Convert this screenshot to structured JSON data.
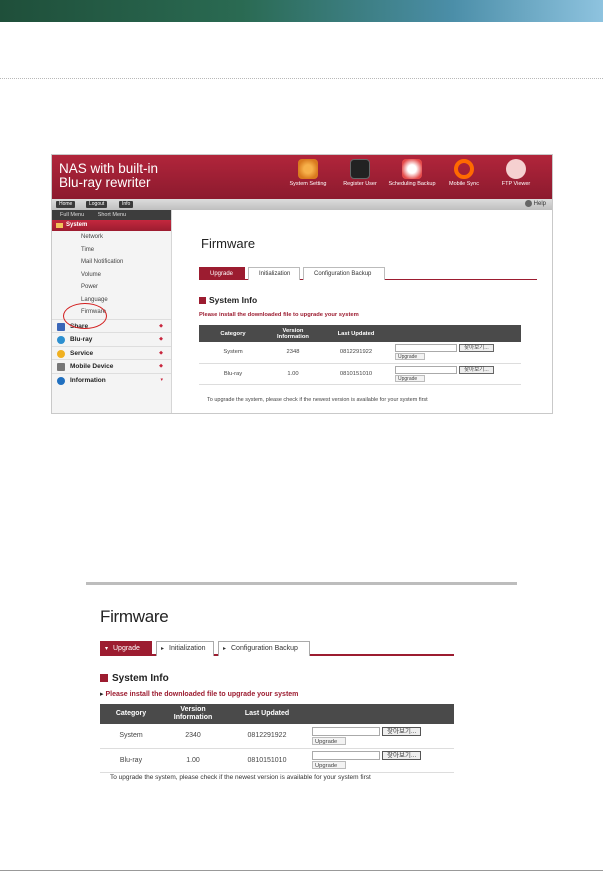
{
  "app": {
    "title_line1": "NAS with built-in",
    "title_line2": "Blu-ray rewriter",
    "header_items": [
      {
        "label": "System Setting",
        "icon": "gear-icon",
        "color": "#d97a1e"
      },
      {
        "label": "Register User",
        "icon": "user-icon",
        "color": "#222222"
      },
      {
        "label": "Scheduling Backup",
        "icon": "clock-icon",
        "color": "#e44a4a"
      },
      {
        "label": "Mobile Sync",
        "icon": "sync-icon",
        "color": "#ff6a00"
      },
      {
        "label": "FTP Viewer",
        "icon": "search-icon",
        "color": "#f0b7b7"
      }
    ],
    "toolbar": {
      "home": "Home",
      "logout": "Logout",
      "info": "Info",
      "help": "Help"
    },
    "sidebar": {
      "full_menu": "Full Menu",
      "short_menu": "Short Menu",
      "system": "System",
      "system_items": [
        "Network",
        "Time",
        "Mail Notification",
        "Volume",
        "Power",
        "Language",
        "Firmware"
      ],
      "categories": [
        {
          "label": "Share",
          "color": "#3a66b8"
        },
        {
          "label": "Blu-ray",
          "color": "#2c8fd0"
        },
        {
          "label": "Service",
          "color": "#f0b020"
        },
        {
          "label": "Mobile Device",
          "color": "#777777"
        },
        {
          "label": "Information",
          "color": "#2070c0"
        }
      ]
    }
  },
  "firmware": {
    "title": "Firmware",
    "tabs": [
      "Upgrade",
      "Initialization",
      "Configuration Backup"
    ],
    "section": "System Info",
    "note": "Please install the downloaded file to upgrade your system",
    "headers": [
      "Category",
      "Version Information",
      "Last Updated"
    ],
    "rows": [
      {
        "category": "System",
        "version": "2348",
        "updated": "0812291922"
      },
      {
        "category": "Blu-ray",
        "version": "1.00",
        "updated": "0810151010"
      }
    ],
    "browse": "찾아보기...",
    "upgrade": "Upgrade",
    "footer": "To upgrade the system, please check if the newest version is available for your system first"
  },
  "firmware_large": {
    "rows": [
      {
        "category": "System",
        "version": "2340",
        "updated": "0812291922"
      },
      {
        "category": "Blu-ray",
        "version": "1.00",
        "updated": "0810151010"
      }
    ]
  }
}
